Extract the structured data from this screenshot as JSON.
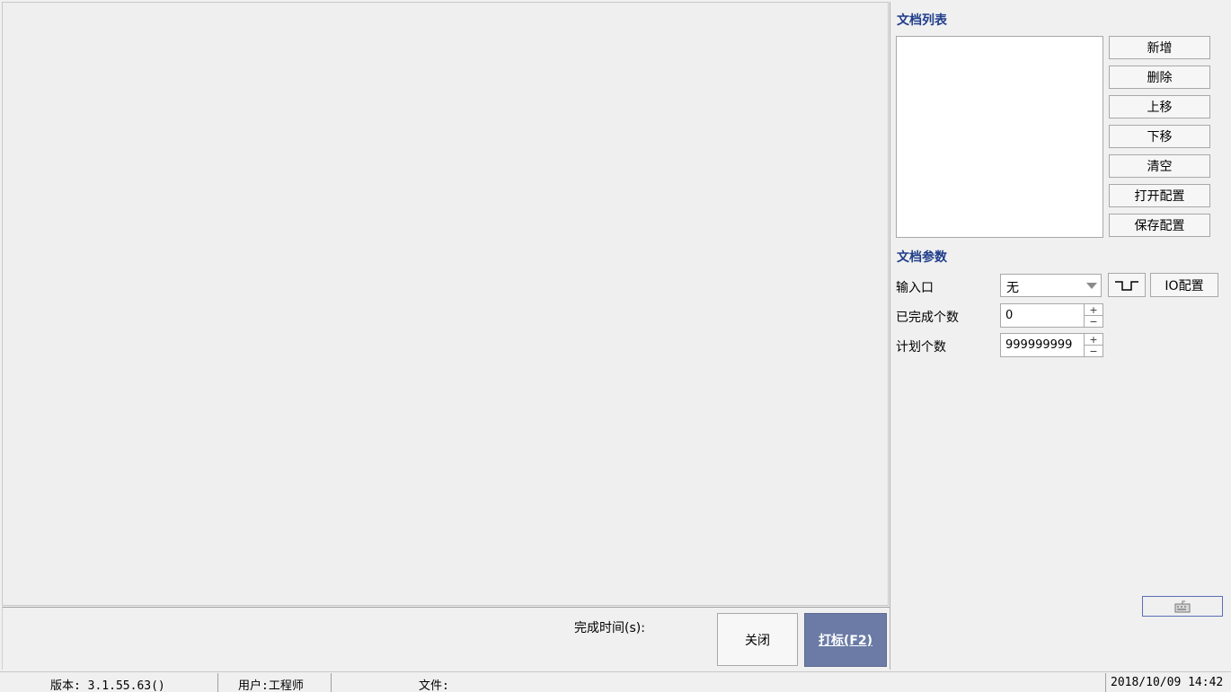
{
  "bottom": {
    "time_label": "完成时间(s):",
    "close_label": "关闭",
    "mark_label": "打标(F2)"
  },
  "doc_list": {
    "title": "文档列表",
    "buttons": [
      "新增",
      "删除",
      "上移",
      "下移",
      "清空",
      "打开配置",
      "保存配置"
    ]
  },
  "doc_params": {
    "title": "文档参数",
    "input_port_label": "输入口",
    "input_port_value": "无",
    "io_config_label": "IO配置",
    "completed_label": "已完成个数",
    "completed_value": "0",
    "planned_label": "计划个数",
    "planned_value": "999999999"
  },
  "status": {
    "version": "版本: 3.1.55.63()",
    "user": "用户:工程师",
    "file": "文件:",
    "datetime": "2018/10/09 14:42"
  },
  "icons": {
    "pulse": "pulse-edge-icon",
    "keyboard": "keyboard-icon"
  }
}
